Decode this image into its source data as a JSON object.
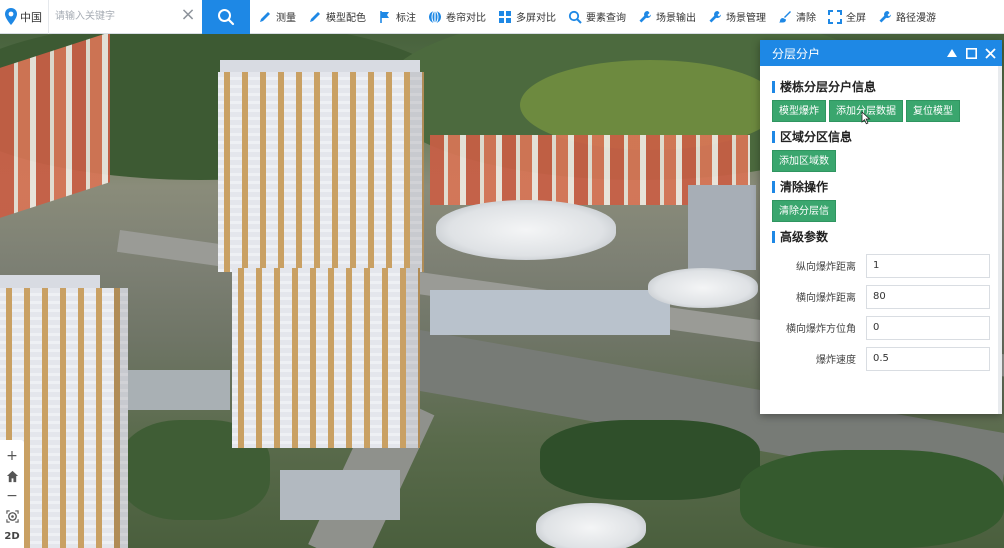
{
  "location": {
    "label": "中国"
  },
  "search": {
    "placeholder": "请输入关键字",
    "value": ""
  },
  "toolbar": {
    "tools": [
      {
        "label": "测量",
        "icon": "ruler-pen-icon"
      },
      {
        "label": "模型配色",
        "icon": "paint-pen-icon"
      },
      {
        "label": "标注",
        "icon": "flag-icon"
      },
      {
        "label": "卷帘对比",
        "icon": "globe-swipe-icon"
      },
      {
        "label": "多屏对比",
        "icon": "grid-icon"
      },
      {
        "label": "要素查询",
        "icon": "search-icon"
      },
      {
        "label": "场景输出",
        "icon": "wrench-icon"
      },
      {
        "label": "场景管理",
        "icon": "wrench-icon"
      },
      {
        "label": "清除",
        "icon": "brush-icon"
      },
      {
        "label": "全屏",
        "icon": "fullscreen-icon"
      },
      {
        "label": "路径漫游",
        "icon": "wrench-icon"
      }
    ]
  },
  "nav": {
    "zoom_in": "+",
    "zoom_out": "−",
    "mode": "2D"
  },
  "panel": {
    "title": "分层分户",
    "sections": {
      "building": {
        "title": "楼栋分层分户信息",
        "buttons": [
          "模型爆炸",
          "添加分层数据",
          "复位模型"
        ]
      },
      "region": {
        "title": "区域分区信息",
        "buttons": [
          "添加区域数"
        ]
      },
      "clear": {
        "title": "清除操作",
        "buttons": [
          "清除分层信"
        ]
      },
      "advanced": {
        "title": "高级参数",
        "params": [
          {
            "label": "纵向爆炸距离",
            "value": "1"
          },
          {
            "label": "横向爆炸距离",
            "value": "80"
          },
          {
            "label": "横向爆炸方位角",
            "value": "0"
          },
          {
            "label": "爆炸速度",
            "value": "0.5"
          }
        ]
      }
    }
  },
  "colors": {
    "accent": "#1e88e5",
    "button_green": "#3aa66e",
    "toolbar_bg": "#ffffff"
  }
}
